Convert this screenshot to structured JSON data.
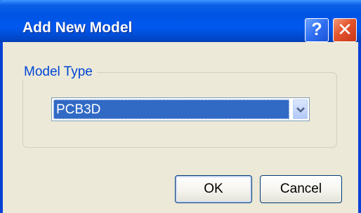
{
  "dialog": {
    "title": "Add New Model",
    "help_glyph": "?",
    "close_glyph": "✕"
  },
  "model_type": {
    "group_label": "Model Type",
    "selected_value": "PCB3D",
    "dropdown_icon": "chevron-down-icon"
  },
  "buttons": {
    "ok_label": "OK",
    "cancel_label": "Cancel"
  },
  "colors": {
    "titlebar": "#0054e3",
    "selection": "#316ac5",
    "group_label": "#0046d5",
    "close_button": "#e4542c"
  }
}
